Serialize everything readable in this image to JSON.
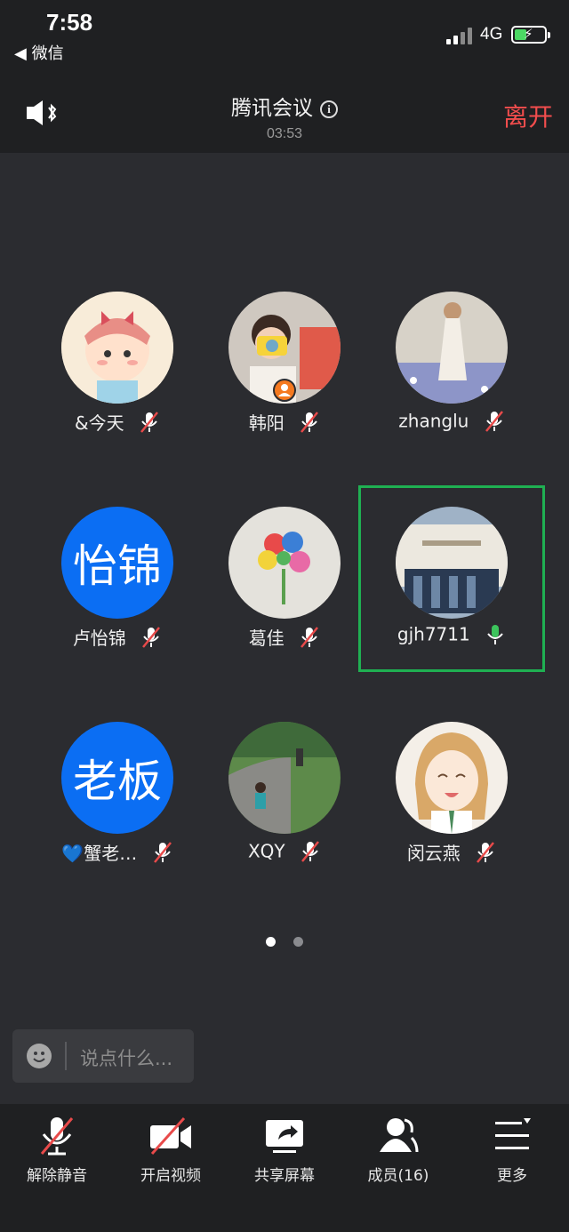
{
  "status_bar": {
    "time": "7:58",
    "back_app": "◀ 微信",
    "network": "4G"
  },
  "header": {
    "title": "腾讯会议",
    "duration": "03:53",
    "leave_label": "离开"
  },
  "participants": [
    {
      "name": "&今天",
      "mic": "muted"
    },
    {
      "name": "韩阳",
      "mic": "muted",
      "host": true
    },
    {
      "name": "zhanglu",
      "mic": "muted"
    },
    {
      "name": "卢怡锦",
      "mic": "muted",
      "avatar_text": "怡锦"
    },
    {
      "name": "葛佳",
      "mic": "muted"
    },
    {
      "name": "gjh7711",
      "mic": "active",
      "highlighted": true
    },
    {
      "name": "💙蟹老…",
      "mic": "muted",
      "avatar_text": "老板"
    },
    {
      "name": "XQY",
      "mic": "muted"
    },
    {
      "name": "闵云燕",
      "mic": "muted"
    }
  ],
  "pagination": {
    "current": 1,
    "total": 2
  },
  "chat": {
    "placeholder": "说点什么..."
  },
  "toolbar": {
    "unmute_label": "解除静音",
    "video_label": "开启视频",
    "share_label": "共享屏幕",
    "members_label": "成员(16)",
    "more_label": "更多"
  },
  "colors": {
    "accent_blue": "#0b6ef3",
    "leave_red": "#f34d4d",
    "active_green": "#1fb052",
    "host_orange": "#f5791f"
  }
}
